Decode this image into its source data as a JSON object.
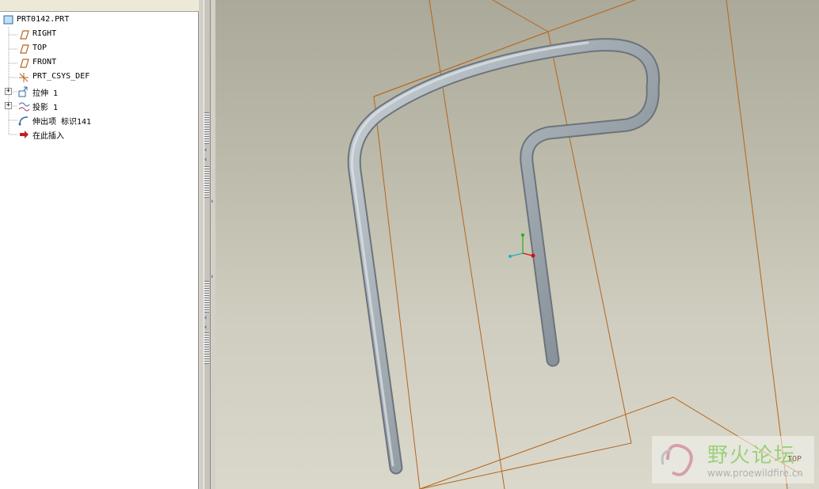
{
  "model_tree": {
    "root_label": "PRT0142.PRT",
    "items": [
      {
        "label": "RIGHT",
        "icon": "datum-plane-icon",
        "expandable": false
      },
      {
        "label": "TOP",
        "icon": "datum-plane-icon",
        "expandable": false
      },
      {
        "label": "FRONT",
        "icon": "datum-plane-icon",
        "expandable": false
      },
      {
        "label": "PRT_CSYS_DEF",
        "icon": "coordinate-system-icon",
        "expandable": false
      },
      {
        "label": "拉伸 1",
        "icon": "extrude-icon",
        "expandable": true
      },
      {
        "label": "投影 1",
        "icon": "projection-icon",
        "expandable": true
      },
      {
        "label": "伸出项 标识141",
        "icon": "sweep-protrusion-icon",
        "expandable": false
      },
      {
        "label": "在此插入",
        "icon": "insert-here-arrow-icon",
        "expandable": false
      }
    ]
  },
  "viewport": {
    "datum_color": "#b5651d",
    "tube_color": "#8a949c",
    "view_label": "TOP"
  },
  "watermark": {
    "title": "野火论坛",
    "url": "www.proewildfire.cn"
  }
}
